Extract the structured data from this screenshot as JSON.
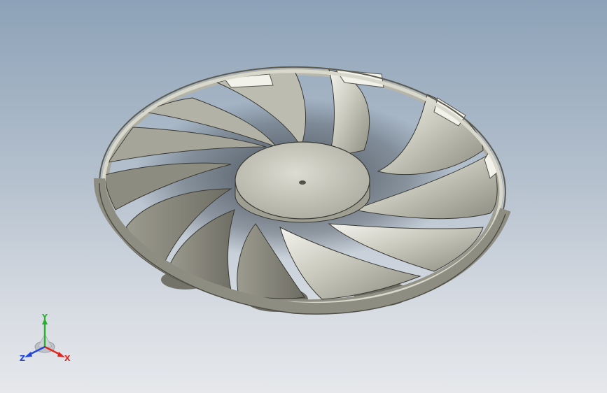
{
  "viewport": {
    "background_top": "#8da2b8",
    "background_bottom": "#e6e8eb",
    "model": "fan-impeller",
    "blade_count": 11
  },
  "triad": {
    "x_label": "X",
    "y_label": "Y",
    "z_label": "Z",
    "x_color": "#e0261c",
    "y_color": "#27b02b",
    "z_color": "#2146d8"
  }
}
